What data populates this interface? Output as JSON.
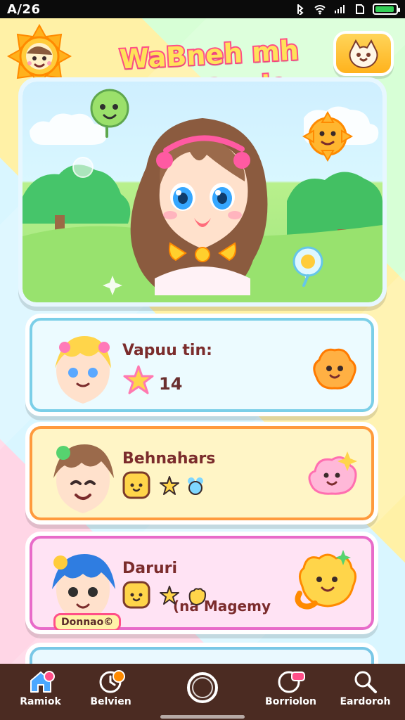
{
  "status_bar": {
    "time": "A/26",
    "icons": [
      "bluetooth-icon",
      "wifi-icon",
      "signal-icon",
      "sim-icon",
      "battery-icon"
    ]
  },
  "header": {
    "title": "WaBneh mh",
    "subtitle": "aang Bowie",
    "left_badge_icon": "sun-character-icon",
    "right_button_icon": "cat-face-icon"
  },
  "hero": {
    "scene": "girl-character-icon"
  },
  "list": {
    "items": [
      {
        "title": "Vapuu tin:",
        "count": "14",
        "accent": "#7bcfe8"
      },
      {
        "title": "Behnahars",
        "accent": "#ff9a3d"
      },
      {
        "title": "Daruri",
        "subtitle": "(na Magemy",
        "tag": "Donnao©",
        "accent": "#e86bc9"
      }
    ]
  },
  "bottom_nav": {
    "items": [
      {
        "label": "Ramiok",
        "icon": "home-icon"
      },
      {
        "label": "Belvien",
        "icon": "clock-icon"
      },
      {
        "label": "",
        "icon": "ring-icon"
      },
      {
        "label": "Borriolon",
        "icon": "camera-icon"
      },
      {
        "label": "Eardoroh",
        "icon": "search-icon"
      }
    ]
  },
  "colors": {
    "nav_bg": "#4b2b22",
    "title_fill": "#ffe25a",
    "title_stroke": "#ff4f88"
  }
}
